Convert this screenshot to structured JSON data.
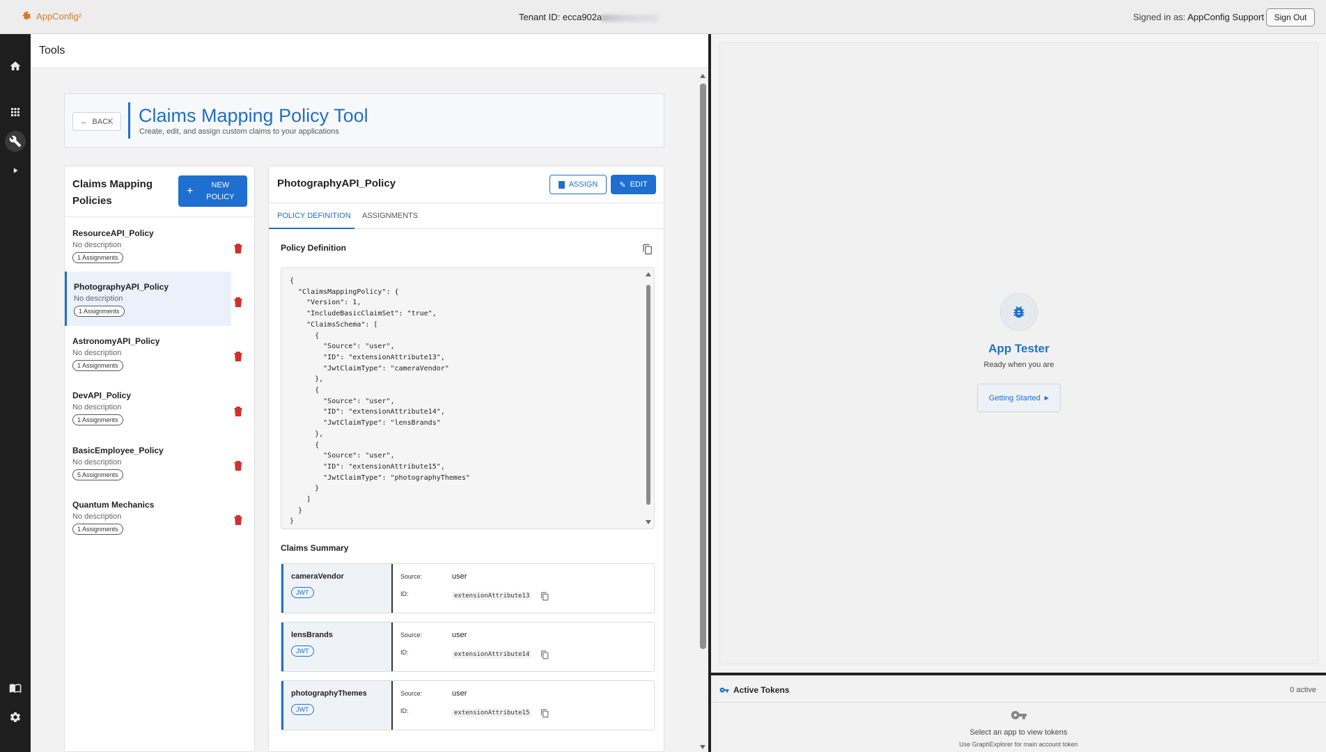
{
  "topbar": {
    "app_name": "AppConfig²",
    "tenant_label": "Tenant ID: ecca902a",
    "signed_in_label": "Signed in as:",
    "signed_in_user": "AppConfig Support",
    "sign_out": "Sign Out"
  },
  "rail": {
    "icons": [
      "home-icon",
      "apps-grid-icon",
      "wrench-icon",
      "play-icon",
      "book-icon",
      "settings-icon"
    ]
  },
  "tools": {
    "title": "Tools",
    "back": "BACK",
    "hero_title": "Claims Mapping Policy Tool",
    "hero_subtitle": "Create, edit, and assign custom claims to your applications"
  },
  "policy_list": {
    "title": "Claims Mapping Policies",
    "new_button": "NEW POLICY",
    "items": [
      {
        "name": "ResourceAPI_Policy",
        "description": "No description",
        "badge": "1 Assignments",
        "selected": false
      },
      {
        "name": "PhotographyAPI_Policy",
        "description": "No description",
        "badge": "1 Assignments",
        "selected": true
      },
      {
        "name": "AstronomyAPI_Policy",
        "description": "No description",
        "badge": "1 Assignments",
        "selected": false
      },
      {
        "name": "DevAPI_Policy",
        "description": "No description",
        "badge": "1 Assignments",
        "selected": false
      },
      {
        "name": "BasicEmployee_Policy",
        "description": "No description",
        "badge": "5 Assignments",
        "selected": false
      },
      {
        "name": "Quantum Mechanics",
        "description": "No description",
        "badge": "1 Assignments",
        "selected": false
      }
    ]
  },
  "detail": {
    "title": "PhotographyAPI_Policy",
    "assign_button": "ASSIGN",
    "edit_button": "EDIT",
    "tabs": [
      "POLICY DEFINITION",
      "ASSIGNMENTS"
    ],
    "active_tab": "POLICY DEFINITION",
    "definition_label": "Policy Definition",
    "code": "{\n  \"ClaimsMappingPolicy\": {\n    \"Version\": 1,\n    \"IncludeBasicClaimSet\": \"true\",\n    \"ClaimsSchema\": [\n      {\n        \"Source\": \"user\",\n        \"ID\": \"extensionAttribute13\",\n        \"JwtClaimType\": \"cameraVendor\"\n      },\n      {\n        \"Source\": \"user\",\n        \"ID\": \"extensionAttribute14\",\n        \"JwtClaimType\": \"lensBrands\"\n      },\n      {\n        \"Source\": \"user\",\n        \"ID\": \"extensionAttribute15\",\n        \"JwtClaimType\": \"photographyThemes\"\n      }\n    ]\n  }\n}",
    "summary_label": "Claims Summary",
    "claims": [
      {
        "name": "cameraVendor",
        "tag": "JWT",
        "source_label": "Source:",
        "source": "user",
        "id_label": "ID:",
        "id": "extensionAttribute13"
      },
      {
        "name": "lensBrands",
        "tag": "JWT",
        "source_label": "Source:",
        "source": "user",
        "id_label": "ID:",
        "id": "extensionAttribute14"
      },
      {
        "name": "photographyThemes",
        "tag": "JWT",
        "source_label": "Source:",
        "source": "user",
        "id_label": "ID:",
        "id": "extensionAttribute15"
      }
    ]
  },
  "tester": {
    "title": "App Tester",
    "subtitle": "Ready when you are",
    "button": "Getting Started"
  },
  "tokens": {
    "title": "Active Tokens",
    "count": "0 active",
    "message": "Select an app to view tokens",
    "hint": "Use GraphExplorer for main account token"
  },
  "colors": {
    "accent": "#1e6fd0",
    "danger": "#d32f2f",
    "rail": "#1e1e1e",
    "logo": "#d9772b"
  }
}
